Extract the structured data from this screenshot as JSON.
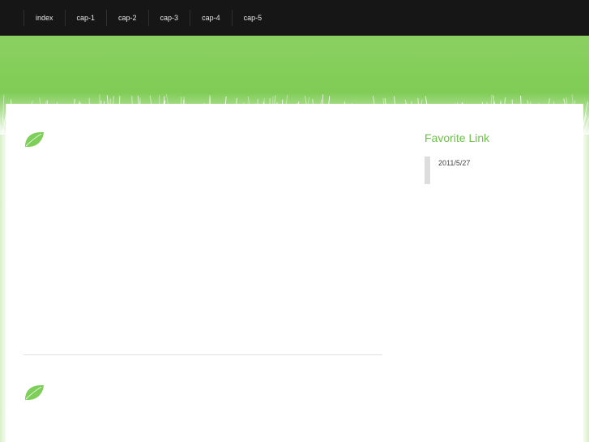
{
  "nav": {
    "items": [
      {
        "label": "index"
      },
      {
        "label": "cap-1"
      },
      {
        "label": "cap-2"
      },
      {
        "label": "cap-3"
      },
      {
        "label": "cap-4"
      },
      {
        "label": "cap-5"
      }
    ]
  },
  "sidebar": {
    "title": "Favorite Link",
    "items": [
      {
        "date": "2011/5/27"
      }
    ]
  },
  "colors": {
    "topbar": "#161616",
    "header_green": "#7fcc55",
    "accent": "#6cc24a",
    "leaf": "#7dcf5a"
  },
  "icons": {
    "post_marker": "leaf-icon"
  }
}
